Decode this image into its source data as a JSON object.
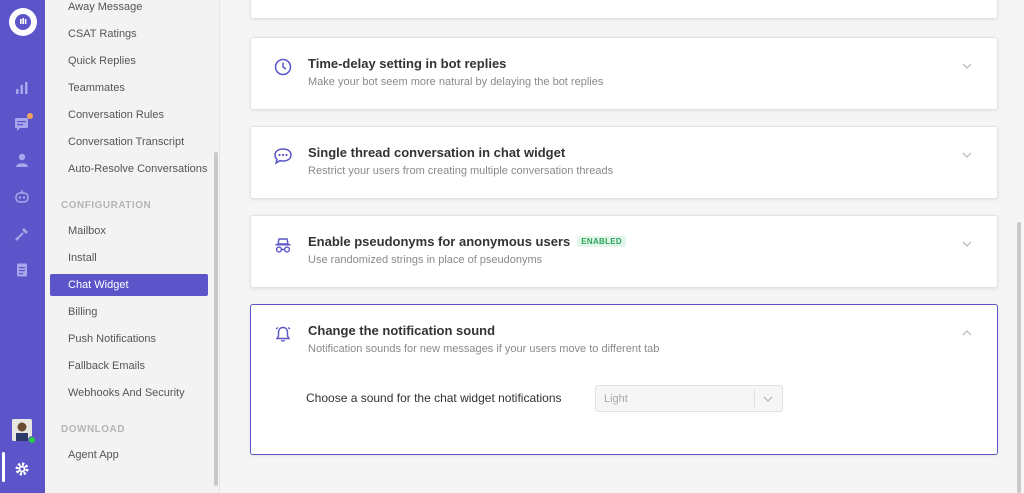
{
  "sidebar": {
    "items_top": [
      {
        "label": "Away Message"
      },
      {
        "label": "CSAT Ratings"
      },
      {
        "label": "Quick Replies"
      },
      {
        "label": "Teammates"
      },
      {
        "label": "Conversation Rules"
      },
      {
        "label": "Conversation Transcript"
      },
      {
        "label": "Auto-Resolve Conversations"
      }
    ],
    "section_configuration": "CONFIGURATION",
    "items_config": [
      {
        "label": "Mailbox"
      },
      {
        "label": "Install"
      },
      {
        "label": "Chat Widget"
      },
      {
        "label": "Billing"
      },
      {
        "label": "Push Notifications"
      },
      {
        "label": "Fallback Emails"
      },
      {
        "label": "Webhooks And Security"
      }
    ],
    "section_download": "DOWNLOAD",
    "items_download": [
      {
        "label": "Agent App"
      }
    ],
    "active_item": "Chat Widget"
  },
  "rail": {
    "icons": [
      "logo-chat-icon",
      "reports-icon",
      "conversations-icon",
      "users-icon",
      "bot-icon",
      "integrations-icon",
      "docs-icon",
      "settings-icon"
    ],
    "accent_color": "#5b55c9",
    "notification_color": "#f5a25d",
    "online_color": "#2ecc40"
  },
  "cards": [
    {
      "title": "Time-delay setting in bot replies",
      "description": "Make your bot seem more natural by delaying the bot replies",
      "icon": "clock-icon",
      "expanded": false
    },
    {
      "title": "Single thread conversation in chat widget",
      "description": "Restrict your users from creating multiple conversation threads",
      "icon": "chat-bubble-icon",
      "expanded": false
    },
    {
      "title": "Enable pseudonyms for anonymous users",
      "badge": "ENABLED",
      "description": "Use randomized strings in place of pseudonyms",
      "icon": "incognito-icon",
      "expanded": false
    },
    {
      "title": "Change the notification sound",
      "description": "Notification sounds for new messages if your users move to different tab",
      "icon": "bell-icon",
      "expanded": true,
      "sound_label": "Choose a sound for the chat widget notifications",
      "sound_value": "Light"
    }
  ]
}
